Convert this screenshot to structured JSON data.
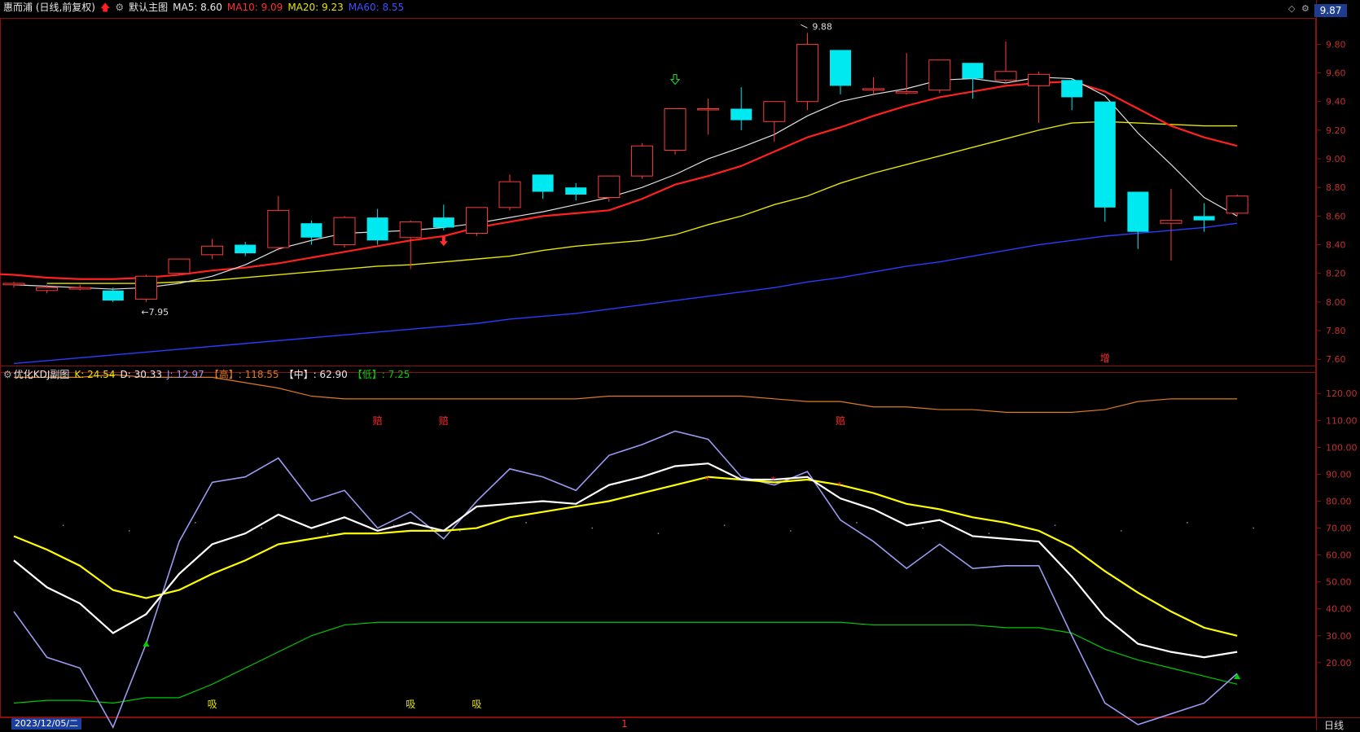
{
  "main_header": {
    "stock": "惠而浦 (日线,前复权)",
    "template": "默认主图",
    "ma5": "MA5: 8.60",
    "ma10": "MA10: 9.09",
    "ma20": "MA20: 9.23",
    "ma60": "MA60: 8.55"
  },
  "sub_header": {
    "title": "优化KDJ副图",
    "k": "K: 24.54",
    "d": "D: 30.33",
    "j": "J: 12.97",
    "high": "【高】: 118.55",
    "mid": "【中】: 62.90",
    "low": "【低】: 7.25"
  },
  "current_price": "9.87",
  "date_label": "2023/12/05/二",
  "period_label": "日线",
  "cursor_label": "1",
  "colors": {
    "up": "#ff3b3b",
    "down": "#00e8f0",
    "ma5": "#e0e0e0",
    "ma10": "#ff2020",
    "ma20": "#e6e600",
    "ma60": "#2a3cff",
    "k": "#ffffff",
    "d": "#ffff00",
    "j": "#9a9af0",
    "high": "#e07a20",
    "low": "#00c800"
  },
  "chart_data": [
    {
      "type": "candlestick",
      "panel": "main",
      "yaxis_ticks": [
        "9.80",
        "9.60",
        "9.40",
        "9.20",
        "9.00",
        "8.80",
        "8.60",
        "8.40",
        "8.20",
        "8.00",
        "7.80",
        "7.60"
      ],
      "ylim": [
        7.55,
        9.95
      ],
      "candles": [
        {
          "o": 8.12,
          "h": 8.14,
          "l": 8.1,
          "c": 8.13
        },
        {
          "o": 8.08,
          "h": 8.12,
          "l": 8.06,
          "c": 8.1
        },
        {
          "o": 8.09,
          "h": 8.12,
          "l": 8.08,
          "c": 8.1
        },
        {
          "o": 8.08,
          "h": 8.1,
          "l": 8.0,
          "c": 8.01
        },
        {
          "o": 8.02,
          "h": 8.19,
          "l": 8.0,
          "c": 8.18
        },
        {
          "o": 8.2,
          "h": 8.3,
          "l": 8.19,
          "c": 8.3
        },
        {
          "o": 8.33,
          "h": 8.44,
          "l": 8.3,
          "c": 8.39
        },
        {
          "o": 8.4,
          "h": 8.42,
          "l": 8.32,
          "c": 8.34
        },
        {
          "o": 8.38,
          "h": 8.74,
          "l": 8.36,
          "c": 8.64
        },
        {
          "o": 8.55,
          "h": 8.57,
          "l": 8.4,
          "c": 8.45
        },
        {
          "o": 8.4,
          "h": 8.6,
          "l": 8.38,
          "c": 8.59
        },
        {
          "o": 8.59,
          "h": 8.65,
          "l": 8.4,
          "c": 8.43
        },
        {
          "o": 8.45,
          "h": 8.57,
          "l": 8.23,
          "c": 8.56
        },
        {
          "o": 8.59,
          "h": 8.68,
          "l": 8.5,
          "c": 8.52
        },
        {
          "o": 8.48,
          "h": 8.66,
          "l": 8.46,
          "c": 8.66
        },
        {
          "o": 8.66,
          "h": 8.89,
          "l": 8.64,
          "c": 8.84
        },
        {
          "o": 8.89,
          "h": 8.89,
          "l": 8.72,
          "c": 8.77
        },
        {
          "o": 8.8,
          "h": 8.83,
          "l": 8.71,
          "c": 8.75
        },
        {
          "o": 8.73,
          "h": 8.88,
          "l": 8.7,
          "c": 8.88
        },
        {
          "o": 8.88,
          "h": 9.11,
          "l": 8.86,
          "c": 9.09
        },
        {
          "o": 9.06,
          "h": 9.35,
          "l": 9.03,
          "c": 9.35
        },
        {
          "o": 9.35,
          "h": 9.42,
          "l": 9.17,
          "c": 9.35
        },
        {
          "o": 9.35,
          "h": 9.5,
          "l": 9.2,
          "c": 9.27
        },
        {
          "o": 9.26,
          "h": 9.4,
          "l": 9.12,
          "c": 9.4
        },
        {
          "o": 9.4,
          "h": 9.88,
          "l": 9.34,
          "c": 9.8
        },
        {
          "o": 9.76,
          "h": 9.76,
          "l": 9.45,
          "c": 9.51
        },
        {
          "o": 9.48,
          "h": 9.57,
          "l": 9.45,
          "c": 9.49
        },
        {
          "o": 9.46,
          "h": 9.74,
          "l": 9.45,
          "c": 9.47
        },
        {
          "o": 9.48,
          "h": 9.69,
          "l": 9.46,
          "c": 9.69
        },
        {
          "o": 9.67,
          "h": 9.67,
          "l": 9.42,
          "c": 9.56
        },
        {
          "o": 9.55,
          "h": 9.82,
          "l": 9.53,
          "c": 9.61
        },
        {
          "o": 9.51,
          "h": 9.61,
          "l": 9.25,
          "c": 9.59
        },
        {
          "o": 9.55,
          "h": 9.56,
          "l": 9.34,
          "c": 9.43
        },
        {
          "o": 9.4,
          "h": 9.4,
          "l": 8.56,
          "c": 8.66
        },
        {
          "o": 8.77,
          "h": 8.77,
          "l": 8.37,
          "c": 8.49
        },
        {
          "o": 8.55,
          "h": 8.79,
          "l": 8.29,
          "c": 8.57
        },
        {
          "o": 8.6,
          "h": 8.69,
          "l": 8.49,
          "c": 8.57
        },
        {
          "o": 8.62,
          "h": 8.75,
          "l": 8.6,
          "c": 8.74
        }
      ],
      "ma5": [
        8.12,
        8.11,
        8.1,
        8.09,
        8.1,
        8.13,
        8.18,
        8.26,
        8.37,
        8.43,
        8.48,
        8.49,
        8.5,
        8.52,
        8.55,
        8.59,
        8.63,
        8.68,
        8.73,
        8.8,
        8.89,
        9.0,
        9.08,
        9.17,
        9.3,
        9.4,
        9.45,
        9.49,
        9.55,
        9.56,
        9.53,
        9.57,
        9.56,
        9.44,
        9.18,
        8.96,
        8.73,
        8.6
      ],
      "ma10": [
        8.2,
        8.2,
        8.19,
        8.17,
        8.16,
        8.16,
        8.17,
        8.19,
        8.22,
        8.24,
        8.27,
        8.31,
        8.35,
        8.39,
        8.43,
        8.46,
        8.52,
        8.56,
        8.6,
        8.62,
        8.64,
        8.72,
        8.82,
        8.88,
        8.95,
        9.05,
        9.15,
        9.22,
        9.3,
        9.37,
        9.43,
        9.47,
        9.51,
        9.53,
        9.54,
        9.47,
        9.35,
        9.23,
        9.15,
        9.09
      ],
      "ma20": [
        8.13,
        8.13,
        8.13,
        8.13,
        8.14,
        8.15,
        8.17,
        8.19,
        8.21,
        8.23,
        8.25,
        8.26,
        8.28,
        8.3,
        8.32,
        8.36,
        8.39,
        8.41,
        8.43,
        8.47,
        8.54,
        8.6,
        8.68,
        8.74,
        8.83,
        8.9,
        8.96,
        9.02,
        9.08,
        9.14,
        9.2,
        9.25,
        9.26,
        9.25,
        9.24,
        9.23,
        9.23
      ],
      "ma60": [
        7.57,
        7.59,
        7.61,
        7.63,
        7.65,
        7.67,
        7.69,
        7.71,
        7.73,
        7.75,
        7.77,
        7.79,
        7.81,
        7.83,
        7.85,
        7.88,
        7.9,
        7.92,
        7.95,
        7.98,
        8.01,
        8.04,
        8.07,
        8.1,
        8.14,
        8.17,
        8.21,
        8.25,
        8.28,
        8.32,
        8.36,
        8.4,
        8.43,
        8.46,
        8.48,
        8.5,
        8.52,
        8.55
      ],
      "annotations": [
        {
          "text": "←7.95",
          "index": 4
        },
        {
          "text": "9.88",
          "index": 24
        },
        {
          "text": "增",
          "index": 33
        }
      ]
    },
    {
      "type": "line",
      "panel": "kdj",
      "yaxis_ticks": [
        "120.00",
        "110.00",
        "100.00",
        "90.00",
        "80.00",
        "70.00",
        "60.00",
        "50.00",
        "40.00",
        "30.00",
        "20.00"
      ],
      "ylim": [
        0,
        124
      ],
      "series": [
        {
          "name": "K",
          "values": [
            58,
            48,
            42,
            31,
            38,
            53,
            64,
            68,
            75,
            70,
            74,
            69,
            72,
            69,
            78,
            79,
            80,
            79,
            86,
            89,
            93,
            94,
            88,
            88,
            89,
            81,
            77,
            71,
            73,
            67,
            66,
            65,
            52,
            37,
            27,
            24,
            22,
            24
          ]
        },
        {
          "name": "D",
          "values": [
            67,
            62,
            56,
            47,
            44,
            47,
            53,
            58,
            64,
            66,
            68,
            68,
            69,
            69,
            70,
            74,
            76,
            78,
            80,
            83,
            86,
            89,
            88,
            87,
            88,
            86,
            83,
            79,
            77,
            74,
            72,
            69,
            63,
            54,
            46,
            39,
            33,
            30
          ]
        },
        {
          "name": "J",
          "values": [
            39,
            22,
            18,
            -5,
            27,
            65,
            87,
            89,
            96,
            80,
            84,
            70,
            76,
            66,
            80,
            92,
            89,
            84,
            97,
            101,
            106,
            103,
            89,
            86,
            91,
            73,
            65,
            55,
            64,
            55,
            56,
            56,
            30,
            5,
            -3,
            1,
            5,
            16
          ]
        },
        {
          "name": "高",
          "values": [
            126,
            126,
            126,
            127,
            126,
            126,
            126,
            124,
            122,
            119,
            118,
            118,
            118,
            118,
            118,
            118,
            118,
            118,
            119,
            119,
            119,
            119,
            119,
            118,
            117,
            117,
            115,
            115,
            114,
            114,
            113,
            113,
            113,
            114,
            117,
            118,
            118,
            118
          ]
        },
        {
          "name": "低",
          "values": [
            5,
            6,
            6,
            5,
            7,
            7,
            12,
            18,
            24,
            30,
            34,
            35,
            35,
            35,
            35,
            35,
            35,
            35,
            35,
            35,
            35,
            35,
            35,
            35,
            35,
            35,
            34,
            34,
            34,
            34,
            33,
            33,
            31,
            25,
            21,
            18,
            15,
            12
          ]
        }
      ],
      "annotations": [
        {
          "text": "吸",
          "index": 6
        },
        {
          "text": "吸",
          "index": 12
        },
        {
          "text": "吸",
          "index": 14
        },
        {
          "text": "赔",
          "index": 11
        },
        {
          "text": "赔",
          "index": 13
        },
        {
          "text": "赔",
          "index": 25
        }
      ]
    }
  ]
}
